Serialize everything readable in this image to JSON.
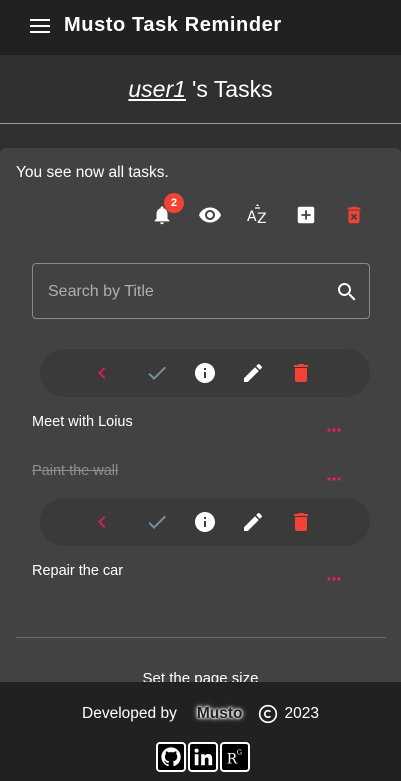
{
  "appbar": {
    "title": "Musto Task Reminder",
    "menu_icon": "menu-icon"
  },
  "header": {
    "user": "user1",
    "suffix": "'s Tasks"
  },
  "status_text": "You see now all tasks.",
  "toolbar": {
    "notifications_count": "2",
    "icons": [
      "bell-icon",
      "eye-icon",
      "sort-az-icon",
      "add-box-icon",
      "delete-forever-icon"
    ]
  },
  "search": {
    "placeholder": "Search by Title"
  },
  "action_bar_icons": [
    "chevron-left-icon",
    "check-icon",
    "info-icon",
    "pencil-icon",
    "trash-icon"
  ],
  "tasks": [
    {
      "title": "Meet with Loius",
      "done": false
    },
    {
      "title": "Paint the wall",
      "done": true
    },
    {
      "title": "Repair the car",
      "done": false
    }
  ],
  "pagination": {
    "label": "Set the page size"
  },
  "footer": {
    "developed_by": "Developed by",
    "brand": "Musto",
    "year": "2023"
  },
  "colors": {
    "accent_pink": "#d81b60",
    "danger_red": "#f44336",
    "check_blue": "#78909c",
    "more_dots": "#e91e63"
  }
}
